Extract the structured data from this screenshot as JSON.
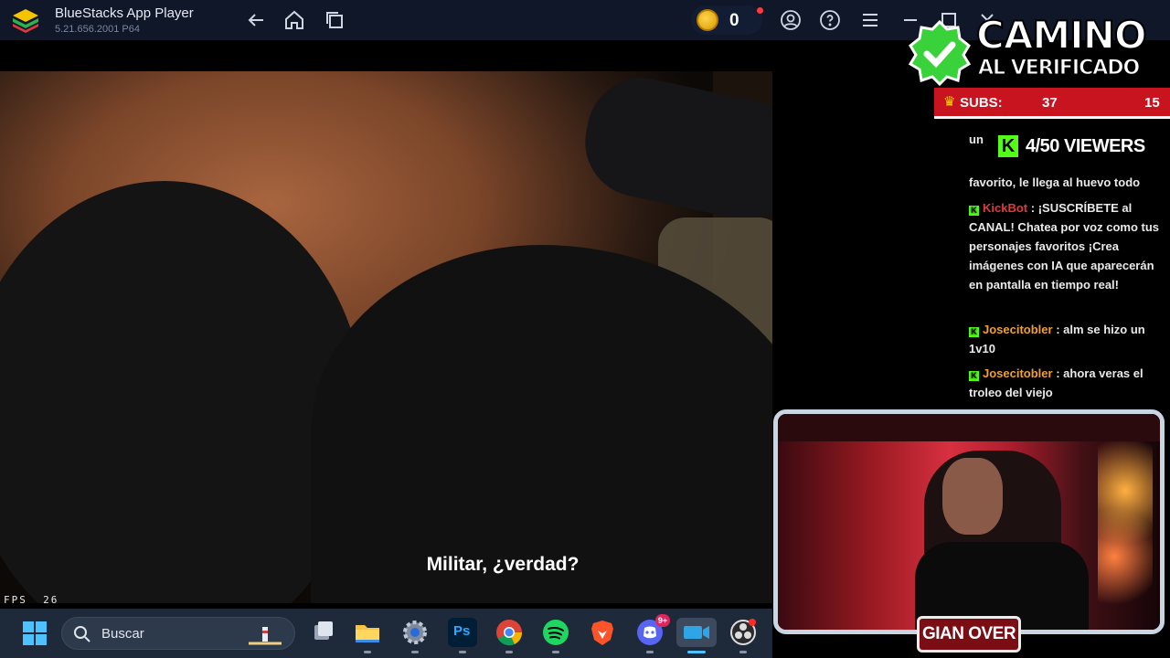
{
  "titlebar": {
    "app_name": "BlueStacks App Player",
    "version": "5.21.656.2001 P64",
    "coins": "0",
    "icons": [
      "back-icon",
      "home-icon",
      "multi-instance-icon",
      "account-icon",
      "help-icon",
      "menu-icon",
      "minimize-icon",
      "maximize-icon",
      "close-icon"
    ]
  },
  "video": {
    "subtitle": "Militar, ¿verdad?",
    "fps_label": "FPS",
    "fps_value": "26"
  },
  "overlay": {
    "banner_line1": "CAMINO",
    "banner_line2": "AL VERIFICADO",
    "subs_label": "SUBS:",
    "subs_count": "37",
    "subs_goal": "15",
    "viewers": "4/50 VIEWERS",
    "webcam_name": "GIAN OVER"
  },
  "chat": {
    "messages": [
      {
        "user": "",
        "text": "un"
      },
      {
        "user": "",
        "text": "favorito, le llega al huevo todo"
      },
      {
        "user": "KickBot",
        "text": "¡SUSCRÍBETE al CANAL! Chatea por voz como tus personajes favoritos ¡Crea imágenes con IA que aparecerán en pantalla en tiempo real!"
      },
      {
        "user": "Josecitobler",
        "text": "alm se hizo un 1v10"
      },
      {
        "user": "Josecitobler",
        "text": "ahora veras el troleo del viejo"
      }
    ]
  },
  "taskbar": {
    "search_placeholder": "Buscar",
    "apps": [
      {
        "name": "task-view",
        "icon": "task-view-icon"
      },
      {
        "name": "file-explorer",
        "icon": "folder-icon"
      },
      {
        "name": "settings",
        "icon": "gear-icon"
      },
      {
        "name": "photoshop",
        "icon": "photoshop-icon",
        "label": "Ps"
      },
      {
        "name": "chrome",
        "icon": "chrome-icon"
      },
      {
        "name": "spotify",
        "icon": "spotify-icon"
      },
      {
        "name": "brave",
        "icon": "brave-icon"
      },
      {
        "name": "discord",
        "icon": "discord-icon",
        "badge": "9+"
      },
      {
        "name": "video-app",
        "icon": "video-camera-icon"
      },
      {
        "name": "obs",
        "icon": "obs-icon"
      }
    ]
  },
  "colors": {
    "titlebar_bg": "#0f1729",
    "kick_green": "#53fc18",
    "subs_red": "#c8141e",
    "taskbar_bg": "#1e2a3a"
  }
}
